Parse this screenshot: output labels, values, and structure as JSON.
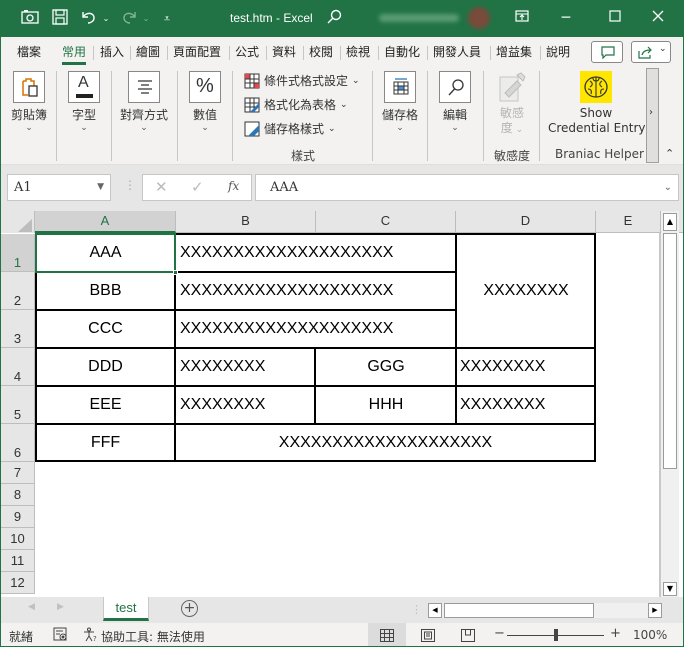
{
  "titlebar": {
    "title": "test.htm  -  Excel",
    "icons": [
      "camera-icon",
      "save-icon",
      "undo-icon",
      "redo-icon",
      "customize-qat-icon",
      "search-icon"
    ],
    "window_buttons": [
      "ribbon-display-icon",
      "minimize-icon",
      "maximize-icon",
      "close-icon"
    ]
  },
  "tabs": [
    {
      "label": "檔案"
    },
    {
      "label": "常用",
      "active": true
    },
    {
      "label": "插入"
    },
    {
      "label": "繪圖"
    },
    {
      "label": "頁面配置"
    },
    {
      "label": "公式"
    },
    {
      "label": "資料"
    },
    {
      "label": "校閱"
    },
    {
      "label": "檢視"
    },
    {
      "label": "自動化"
    },
    {
      "label": "開發人員"
    },
    {
      "label": "增益集"
    },
    {
      "label": "說明"
    }
  ],
  "ribbon": {
    "clipboard": "剪貼簿",
    "font": "字型",
    "alignment": "對齊方式",
    "number": "數值",
    "conditional_format": "條件式格式設定",
    "format_as_table": "格式化為表格",
    "cell_styles": "儲存格樣式",
    "styles_group": "樣式",
    "cells": "儲存格",
    "editing": "編輯",
    "sensitivity_line1": "敏感",
    "sensitivity_line2": "度",
    "sensitivity_group": "敏感度",
    "show_cred_line1": "Show",
    "show_cred_line2": "Credential Entry",
    "braniac_group": "Braniac Helper",
    "accent": "#FFE600"
  },
  "formula_bar": {
    "name_box": "A1",
    "cancel": "✕",
    "enter": "✓",
    "fx": "fx",
    "value": "AAA"
  },
  "columns": [
    "A",
    "B",
    "C",
    "D",
    "E"
  ],
  "rows": [
    "1",
    "2",
    "3",
    "4",
    "5",
    "6",
    "7",
    "8",
    "9",
    "10",
    "11",
    "12"
  ],
  "cells": {
    "A1": "AAA",
    "B1": "XXXXXXXXXXXXXXXXXXXX",
    "D1": "XXXXXXXX",
    "A2": "BBB",
    "B2": "XXXXXXXXXXXXXXXXXXXX",
    "A3": "CCC",
    "B3": "XXXXXXXXXXXXXXXXXXXX",
    "A4": "DDD",
    "B4": "XXXXXXXX",
    "C4": "GGG",
    "D4": "XXXXXXXX",
    "A5": "EEE",
    "B5": "XXXXXXXX",
    "C5": "HHH",
    "D5": "XXXXXXXX",
    "A6": "FFF",
    "B6": "XXXXXXXXXXXXXXXXXXXX"
  },
  "sheet_tabs": [
    {
      "label": "test",
      "active": true
    }
  ],
  "status": {
    "ready": "就緒",
    "accessibility": "協助工具: 無法使用",
    "zoom": "100%"
  },
  "colors": {
    "brand": "#217346"
  }
}
